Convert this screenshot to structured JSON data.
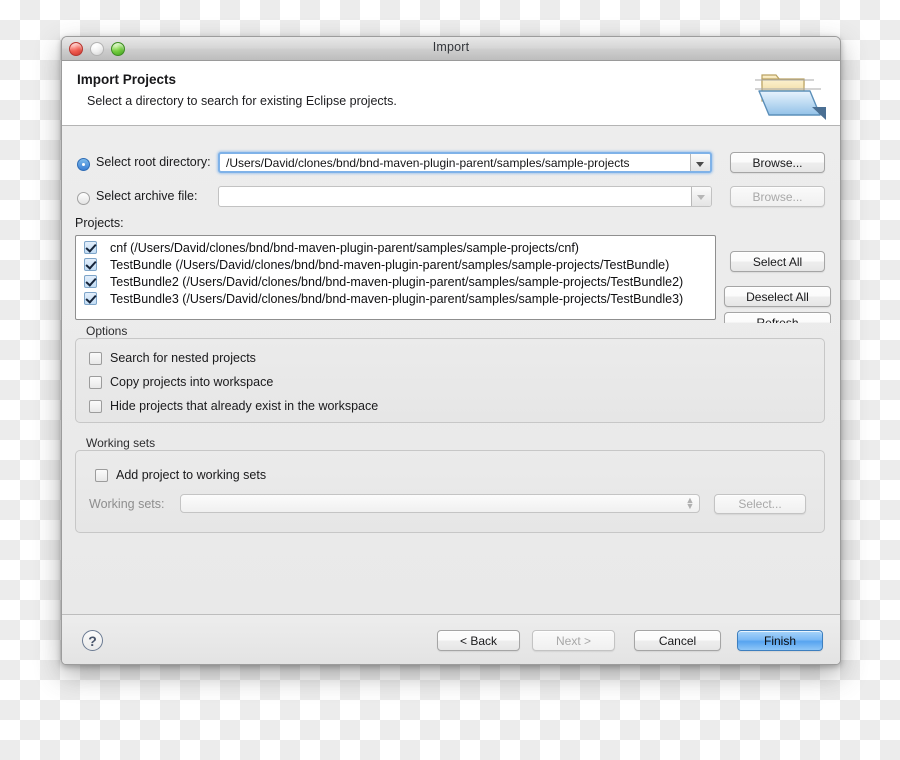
{
  "window": {
    "title": "Import",
    "traffic_lights": [
      "close-button",
      "minimize-button",
      "zoom-button"
    ]
  },
  "header": {
    "title": "Import Projects",
    "subtitle": "Select a directory to search for existing Eclipse projects.",
    "icon": "import-folder-icon"
  },
  "source": {
    "root_radio_label": "Select root directory:",
    "root_value": "/Users/David/clones/bnd/bnd-maven-plugin-parent/samples/sample-projects",
    "root_selected": true,
    "root_browse_label": "Browse...",
    "archive_radio_label": "Select archive file:",
    "archive_value": "",
    "archive_selected": false,
    "archive_browse_label": "Browse..."
  },
  "projects": {
    "label": "Projects:",
    "items": [
      {
        "checked": true,
        "text": "cnf (/Users/David/clones/bnd/bnd-maven-plugin-parent/samples/sample-projects/cnf)"
      },
      {
        "checked": true,
        "text": "TestBundle (/Users/David/clones/bnd/bnd-maven-plugin-parent/samples/sample-projects/TestBundle)"
      },
      {
        "checked": true,
        "text": "TestBundle2 (/Users/David/clones/bnd/bnd-maven-plugin-parent/samples/sample-projects/TestBundle2)"
      },
      {
        "checked": true,
        "text": "TestBundle3 (/Users/David/clones/bnd/bnd-maven-plugin-parent/samples/sample-projects/TestBundle3)"
      }
    ],
    "select_all_label": "Select All",
    "deselect_all_label": "Deselect All",
    "refresh_label": "Refresh"
  },
  "options": {
    "title": "Options",
    "items": [
      {
        "checked": false,
        "label": "Search for nested projects"
      },
      {
        "checked": false,
        "label": "Copy projects into workspace"
      },
      {
        "checked": false,
        "label": "Hide projects that already exist in the workspace"
      }
    ]
  },
  "working_sets": {
    "title": "Working sets",
    "add_checkbox_label": "Add project to working sets",
    "add_checked": false,
    "combo_label": "Working sets:",
    "combo_value": "",
    "select_label": "Select..."
  },
  "footer": {
    "help_glyph": "?",
    "back_label": "< Back",
    "next_label": "Next >",
    "cancel_label": "Cancel",
    "finish_label": "Finish",
    "next_enabled": false,
    "finish_is_default": true
  },
  "colors": {
    "accent_blue": "#7cbaf5",
    "focus_ring": "#7fb2e8",
    "check_fill": "#c3ddf5",
    "window_bg": "#ececec"
  }
}
